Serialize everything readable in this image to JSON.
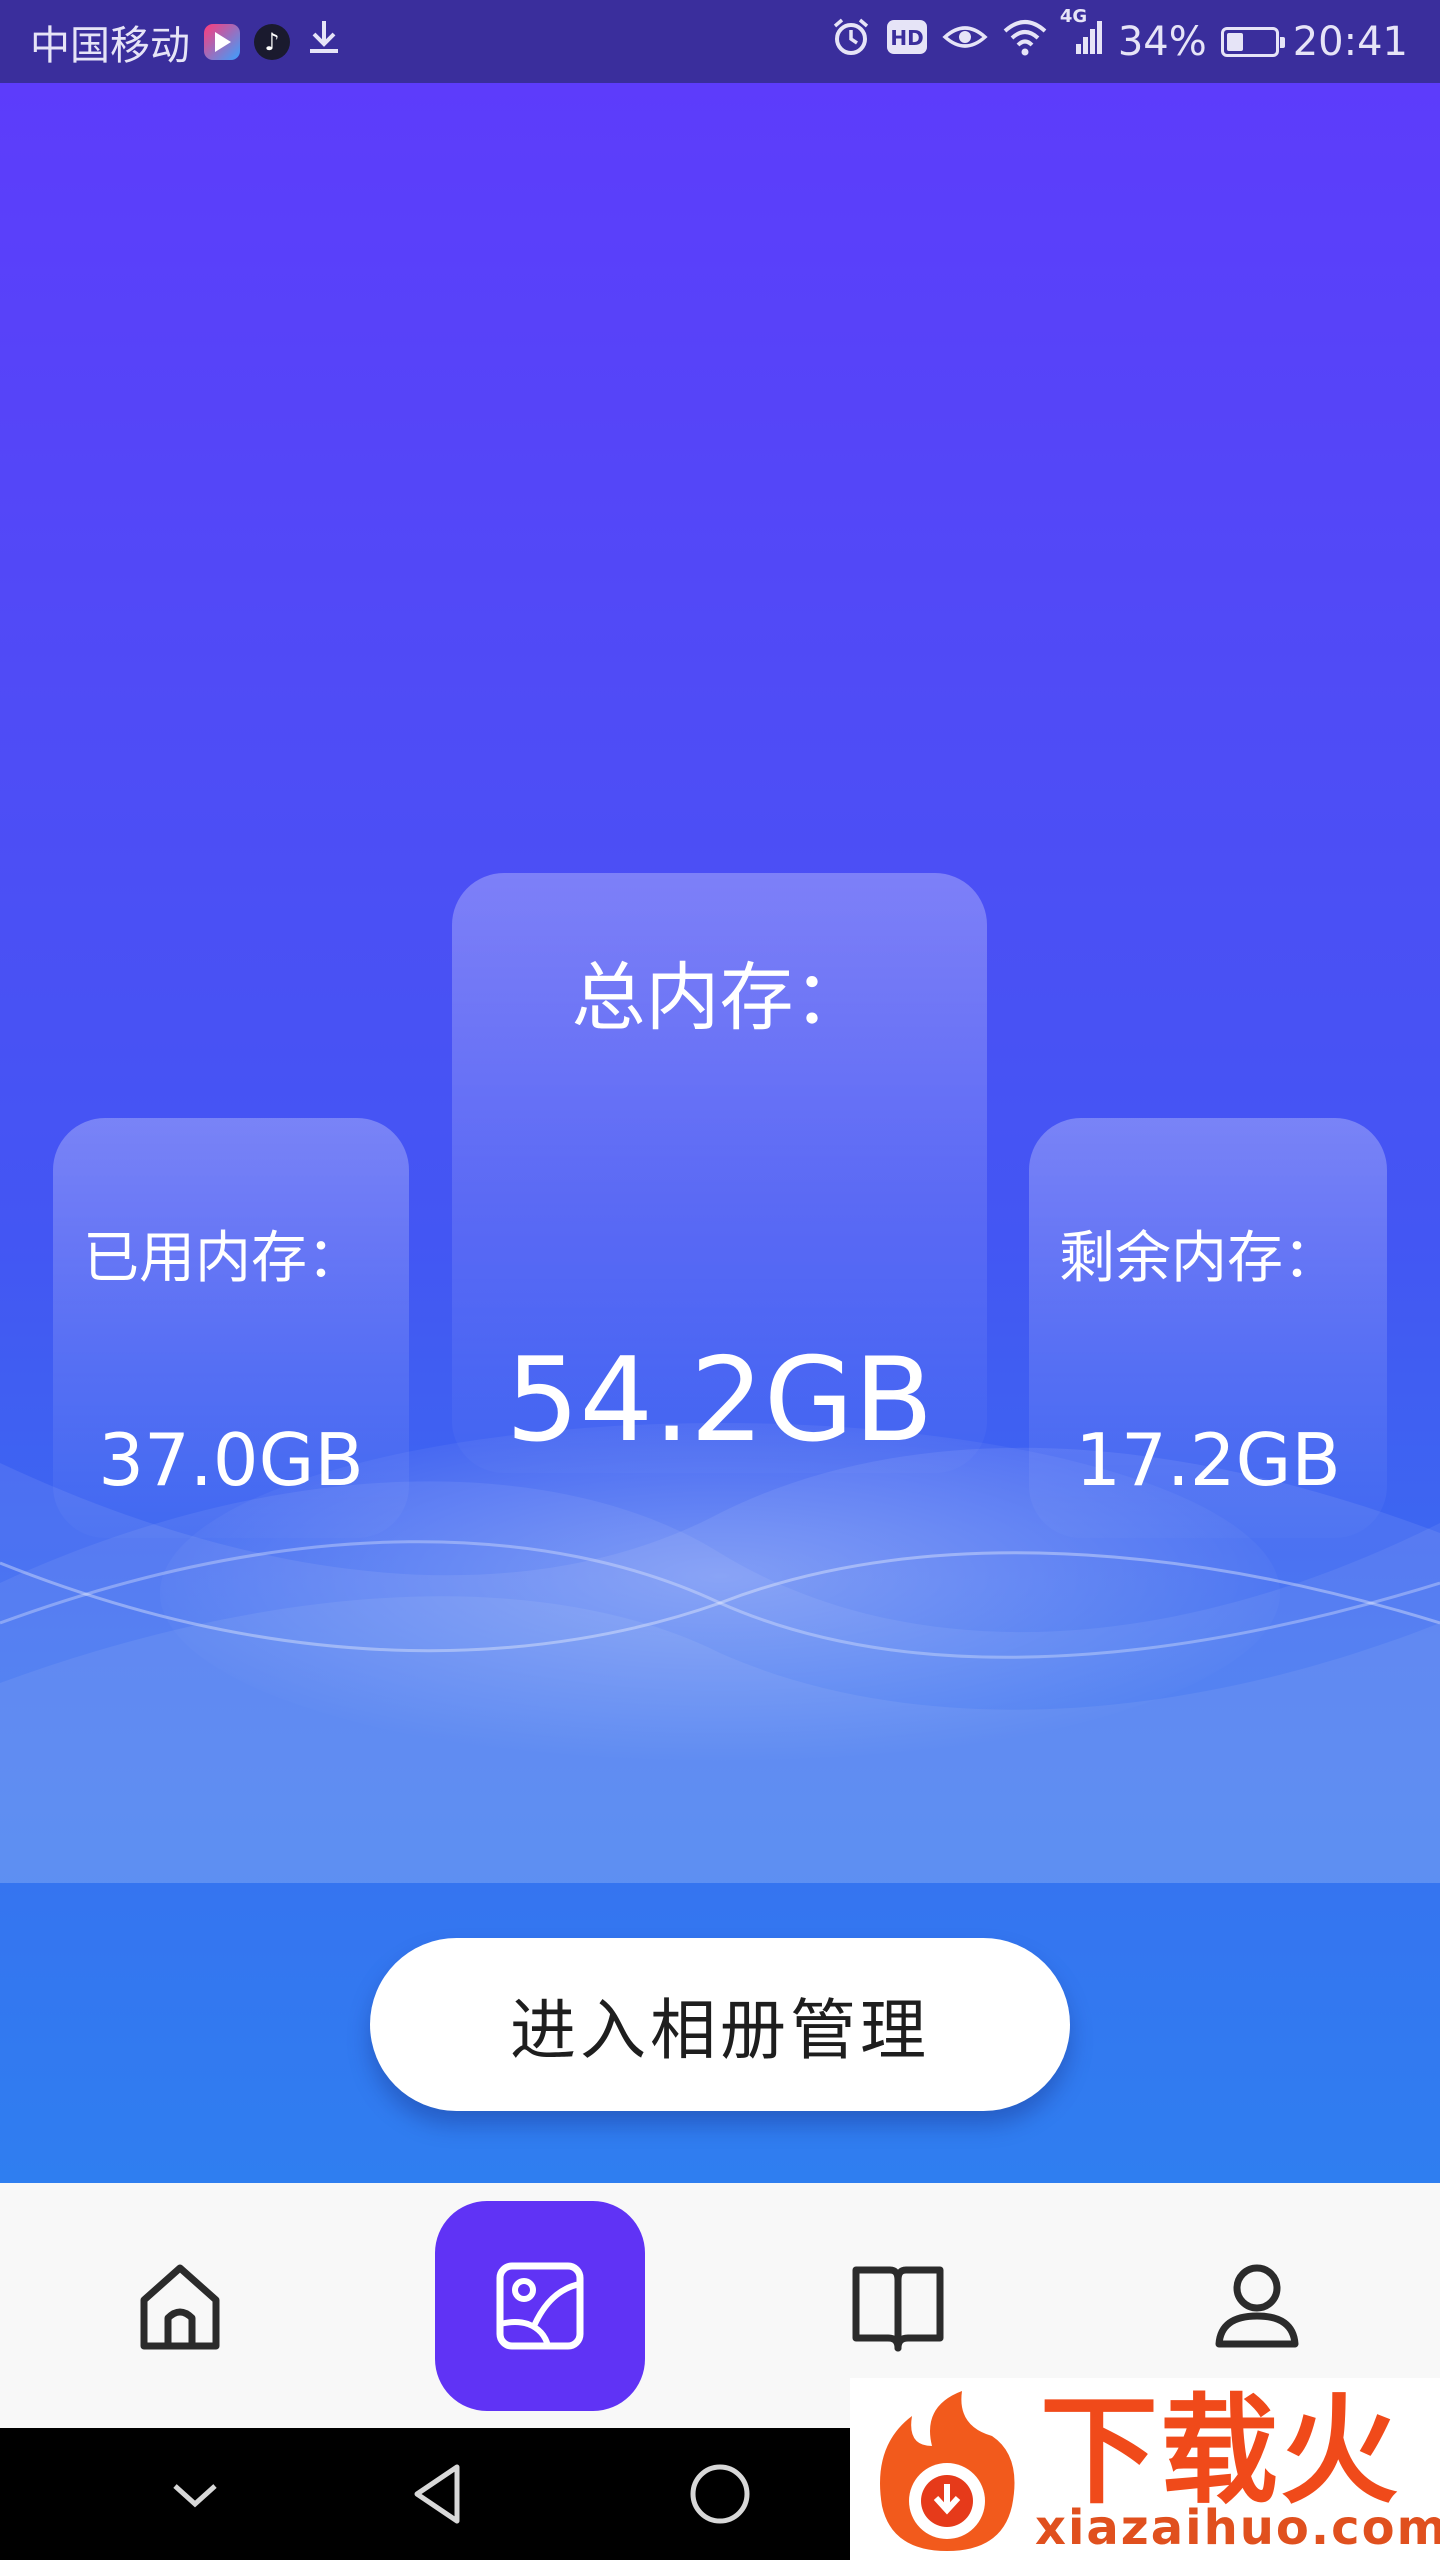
{
  "status_bar": {
    "carrier": "中国移动",
    "network": "4G",
    "battery": "34%",
    "battery_level": 0.34,
    "time": "20:41",
    "icons": [
      "youku-app-icon",
      "douyin-app-icon",
      "download-icon",
      "alarm-icon",
      "hd-icon",
      "eye-icon",
      "wifi-icon",
      "signal-icon",
      "battery-icon"
    ]
  },
  "storage": {
    "used_label": "已用内存：",
    "used_value": "37.0GB",
    "total_label": "总内存：",
    "total_value": "54.2GB",
    "free_label": "剩余内存：",
    "free_value": "17.2GB"
  },
  "actions": {
    "album_button": "进入相册管理"
  },
  "tab_bar": {
    "items": [
      {
        "icon": "home-icon",
        "active": false
      },
      {
        "icon": "album-icon",
        "active": true
      },
      {
        "icon": "book-icon",
        "active": false
      },
      {
        "icon": "profile-icon",
        "active": false
      }
    ],
    "active_color": "#6033f5"
  },
  "watermark": {
    "title": "下载火",
    "url": "xiazaihuo.com"
  },
  "colors": {
    "gradient_top": "#5d3cfb",
    "gradient_bottom": "#2f7ef0",
    "accent": "#6033f5"
  }
}
